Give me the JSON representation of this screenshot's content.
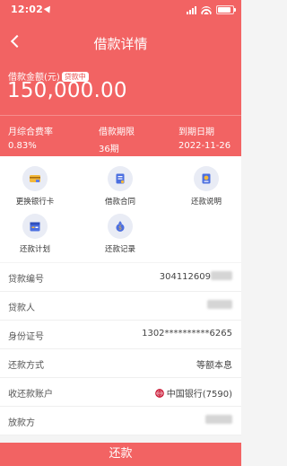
{
  "status_bar": {
    "time": "12:02"
  },
  "header": {
    "title": "借款详情"
  },
  "loan": {
    "amount_label": "借款金额(元)",
    "status_badge": "贷款中",
    "amount": "150,000.00",
    "stats": [
      {
        "label": "月综合费率",
        "value": "0.83%"
      },
      {
        "label": "借款期限",
        "value": "36期"
      },
      {
        "label": "到期日期",
        "value": "2022-11-26"
      }
    ]
  },
  "actions": [
    {
      "label": "更换银行卡",
      "icon": "card-icon"
    },
    {
      "label": "借款合同",
      "icon": "contract-icon"
    },
    {
      "label": "还款说明",
      "icon": "repay-info-icon"
    },
    {
      "label": "还款计划",
      "icon": "plan-icon"
    },
    {
      "label": "还款记录",
      "icon": "record-icon"
    }
  ],
  "details": [
    {
      "label": "贷款编号",
      "value": "304112609"
    },
    {
      "label": "贷款人",
      "value": ""
    },
    {
      "label": "身份证号",
      "value": "1302**********6265"
    },
    {
      "label": "还款方式",
      "value": "等额本息"
    },
    {
      "label": "收还款账户",
      "value": "中国银行(7590)"
    },
    {
      "label": "放款方",
      "value": ""
    }
  ],
  "bottom_button": "还款",
  "colors": {
    "primary": "#f26363",
    "badge_text": "#ea4d4d",
    "icon_bg": "#e9ecf5",
    "bank": "#c8102e"
  }
}
